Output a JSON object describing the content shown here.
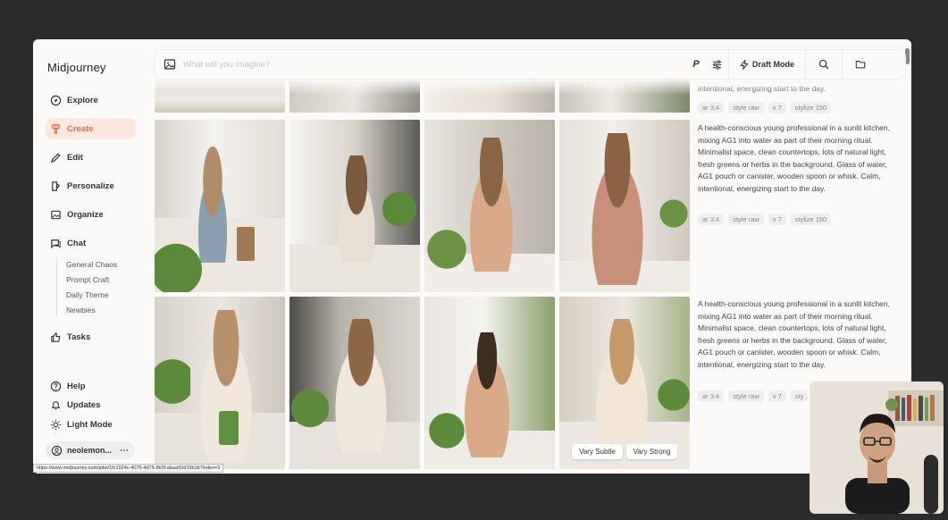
{
  "app": {
    "brand": "Midjourney"
  },
  "sidebar": {
    "items": [
      {
        "label": "Explore",
        "icon": "compass-icon"
      },
      {
        "label": "Create",
        "icon": "brush-icon",
        "active": true
      },
      {
        "label": "Edit",
        "icon": "edit-icon"
      },
      {
        "label": "Personalize",
        "icon": "personalize-icon"
      },
      {
        "label": "Organize",
        "icon": "image-icon"
      },
      {
        "label": "Chat",
        "icon": "chat-icon"
      }
    ],
    "channels": [
      "General Chaos",
      "Prompt Craft",
      "Daily Theme",
      "Newbies"
    ],
    "tasks": {
      "label": "Tasks",
      "icon": "thumbs-up-icon"
    },
    "bottom": [
      {
        "label": "Help",
        "icon": "help-icon"
      },
      {
        "label": "Updates",
        "icon": "bell-icon"
      },
      {
        "label": "Light Mode",
        "icon": "sun-icon"
      }
    ],
    "user": "neolemon..."
  },
  "topbar": {
    "placeholder": "What will you imagine?",
    "p_label": "P",
    "draft_label": "Draft Mode"
  },
  "prompts": [
    {
      "text_tail": "intentional, energizing start to the day.",
      "tags": [
        "ar 3:4",
        "style raw",
        "v 7",
        "stylize 150"
      ]
    },
    {
      "text": "A health-conscious young professional in a sunlit kitchen, mixing AG1 into water as part of their morning ritual. Minimalist space, clean countertops, lots of natural light, fresh greens or herbs in the background. Glass of water, AG1 pouch or canister, wooden spoon or whisk. Calm, intentional, energizing start to the day.",
      "tags": [
        "ar 3:4",
        "style raw",
        "v 7",
        "stylize 150"
      ]
    },
    {
      "text": "A health-conscious young professional in a sunlit kitchen, mixing AG1 into water as part of their morning ritual. Minimalist space, clean countertops, lots of natural light, fresh greens or herbs in the background. Glass of water, AG1 pouch or canister, wooden spoon or whisk. Calm, intentional, energizing start to the day.",
      "tags": [
        "ar 3:4",
        "style raw",
        "v 7",
        "sty"
      ]
    }
  ],
  "vary": {
    "subtle": "Vary Subtle",
    "strong": "Vary Strong"
  },
  "status_url": "https://www.midjourney.com/jobs/1fc1024c-4075-4d75-8b5f-abaa50d15b1b?index=3"
}
